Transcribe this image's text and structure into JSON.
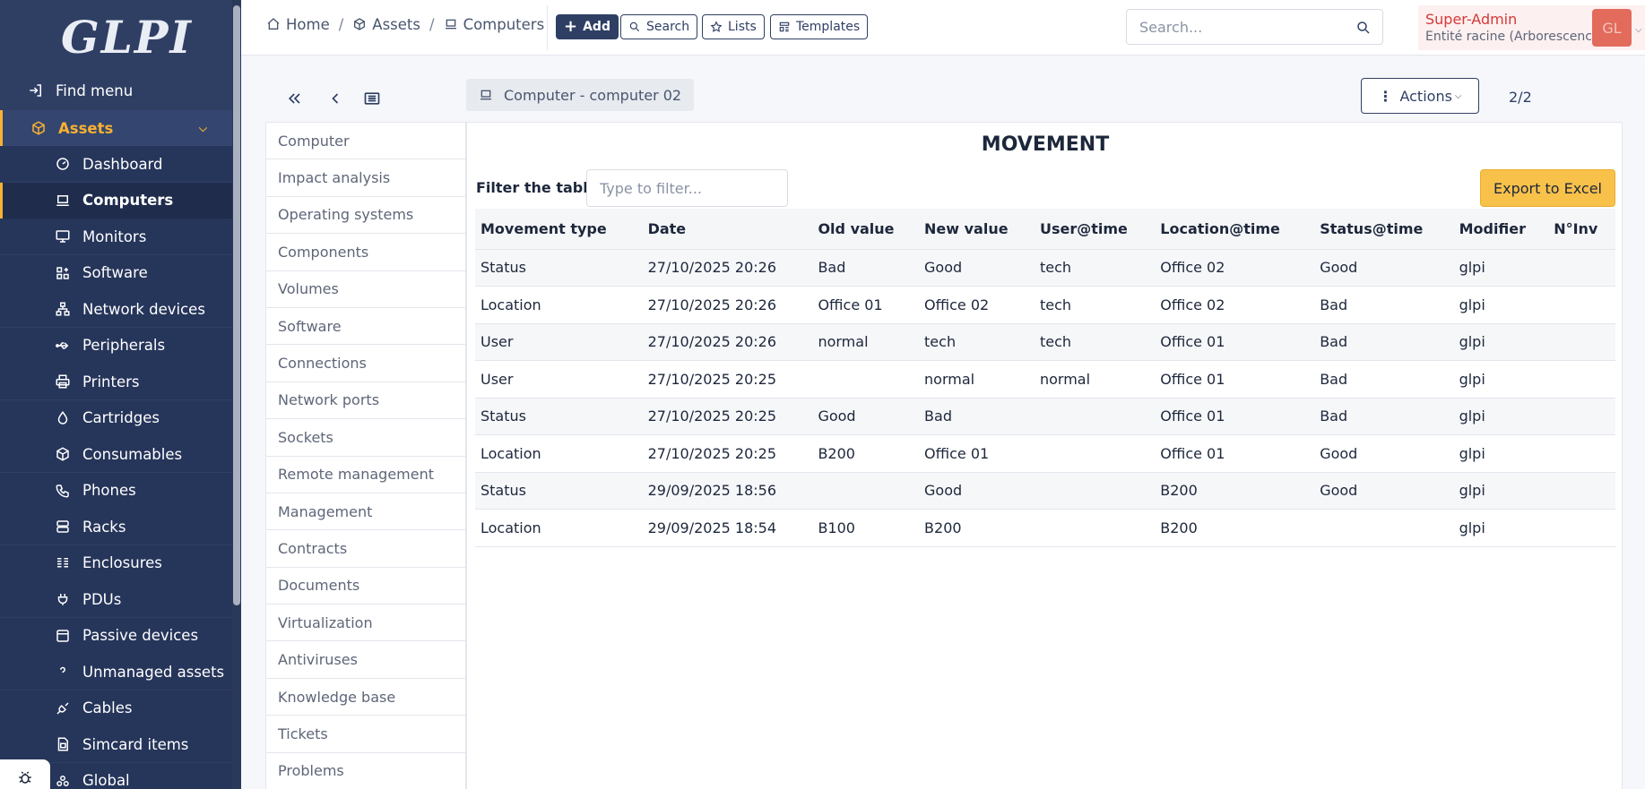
{
  "sidebar": {
    "logo": "GLPI",
    "find_menu": "Find menu",
    "section": "Assets",
    "items": [
      {
        "label": "Dashboard",
        "icon": "dashboard-icon"
      },
      {
        "label": "Computers",
        "icon": "laptop-icon",
        "active": true
      },
      {
        "label": "Monitors",
        "icon": "monitor-icon"
      },
      {
        "label": "Software",
        "icon": "apps-icon"
      },
      {
        "label": "Network devices",
        "icon": "network-icon"
      },
      {
        "label": "Peripherals",
        "icon": "usb-icon"
      },
      {
        "label": "Printers",
        "icon": "printer-icon"
      },
      {
        "label": "Cartridges",
        "icon": "droplet-icon"
      },
      {
        "label": "Consumables",
        "icon": "box-icon"
      },
      {
        "label": "Phones",
        "icon": "phone-icon"
      },
      {
        "label": "Racks",
        "icon": "server-icon"
      },
      {
        "label": "Enclosures",
        "icon": "columns-icon"
      },
      {
        "label": "PDUs",
        "icon": "plug-icon"
      },
      {
        "label": "Passive devices",
        "icon": "device-icon"
      },
      {
        "label": "Unmanaged assets",
        "icon": "question-icon"
      },
      {
        "label": "Cables",
        "icon": "cable-icon"
      },
      {
        "label": "Simcard items",
        "icon": "simcard-icon"
      },
      {
        "label": "Global",
        "icon": "global-icon"
      }
    ]
  },
  "header": {
    "breadcrumb": [
      "Home",
      "Assets",
      "Computers"
    ],
    "buttons": {
      "add": "Add",
      "search": "Search",
      "lists": "Lists",
      "templates": "Templates"
    },
    "search_placeholder": "Search...",
    "user": {
      "name": "Super-Admin",
      "entity": "Entité racine (Arborescence)",
      "initials": "GL"
    }
  },
  "item": {
    "title": "Computer - computer 02",
    "actions": "Actions",
    "pager": "2/2"
  },
  "tabs": [
    "Computer",
    "Impact analysis",
    "Operating systems",
    "Components",
    "Volumes",
    "Software",
    "Connections",
    "Network ports",
    "Sockets",
    "Remote management",
    "Management",
    "Contracts",
    "Documents",
    "Virtualization",
    "Antiviruses",
    "Knowledge base",
    "Tickets",
    "Problems"
  ],
  "movement": {
    "title": "MOVEMENT",
    "filter_label": "Filter the table",
    "filter_placeholder": "Type to filter...",
    "export_label": "Export to Excel",
    "columns": [
      "Movement type",
      "Date",
      "Old value",
      "New value",
      "User@time",
      "Location@time",
      "Status@time",
      "Modifier",
      "N°Inv"
    ],
    "rows": [
      [
        "Status",
        "27/10/2025 20:26",
        "Bad",
        "Good",
        "tech",
        "Office 02",
        "Good",
        "glpi",
        ""
      ],
      [
        "Location",
        "27/10/2025 20:26",
        "Office 01",
        "Office 02",
        "tech",
        "Office 02",
        "Bad",
        "glpi",
        ""
      ],
      [
        "User",
        "27/10/2025 20:26",
        "normal",
        "tech",
        "tech",
        "Office 01",
        "Bad",
        "glpi",
        ""
      ],
      [
        "User",
        "27/10/2025 20:25",
        "",
        "normal",
        "normal",
        "Office 01",
        "Bad",
        "glpi",
        ""
      ],
      [
        "Status",
        "27/10/2025 20:25",
        "Good",
        "Bad",
        "",
        "Office 01",
        "Bad",
        "glpi",
        ""
      ],
      [
        "Location",
        "27/10/2025 20:25",
        "B200",
        "Office 01",
        "",
        "Office 01",
        "Good",
        "glpi",
        ""
      ],
      [
        "Status",
        "29/09/2025 18:56",
        "",
        "Good",
        "",
        "B200",
        "Good",
        "glpi",
        ""
      ],
      [
        "Location",
        "29/09/2025 18:54",
        "B100",
        "B200",
        "",
        "B200",
        "",
        "glpi",
        ""
      ]
    ]
  }
}
